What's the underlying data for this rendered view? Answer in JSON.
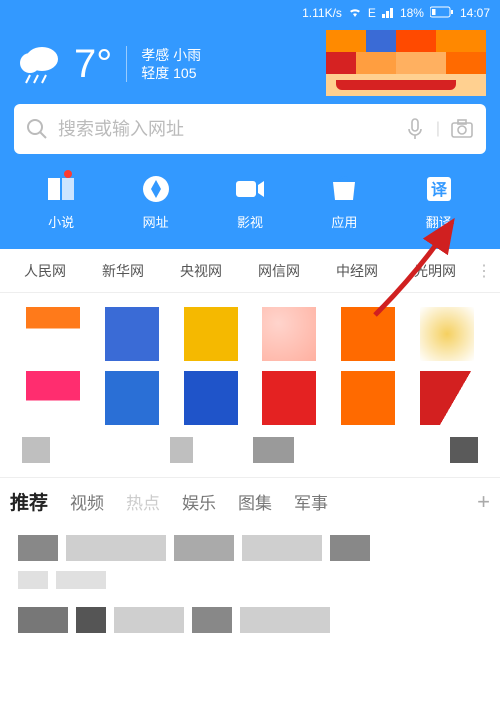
{
  "status": {
    "speed": "1.11K/s",
    "net": "E",
    "battery": "18%",
    "time": "14:07"
  },
  "weather": {
    "temp": "7°",
    "city": "孝感",
    "cond": "小雨",
    "aqi_label": "轻度",
    "aqi_value": "105"
  },
  "search": {
    "placeholder": "搜索或输入网址"
  },
  "quicknav": [
    {
      "label": "小说",
      "icon": "book-icon",
      "dot": true
    },
    {
      "label": "网址",
      "icon": "compass-icon"
    },
    {
      "label": "影视",
      "icon": "video-icon"
    },
    {
      "label": "应用",
      "icon": "bag-icon"
    },
    {
      "label": "翻译",
      "icon": "translate-icon"
    }
  ],
  "news_tabs": [
    "人民网",
    "新华网",
    "央视网",
    "网信网",
    "中经网",
    "光明网"
  ],
  "site_colors_row1": [
    "#ff7a1a",
    "#3a6bd6",
    "#f5b900",
    "#ffd4cc",
    "#ff6a00",
    "#f0e0c0"
  ],
  "site_colors_row2": [
    "#ff2d6f",
    "#2a6fd6",
    "#1f54c9",
    "#e42222",
    "#ff6a00",
    "#d32020"
  ],
  "content_tabs": [
    "推荐",
    "视频",
    "热点",
    "娱乐",
    "图集",
    "军事"
  ]
}
